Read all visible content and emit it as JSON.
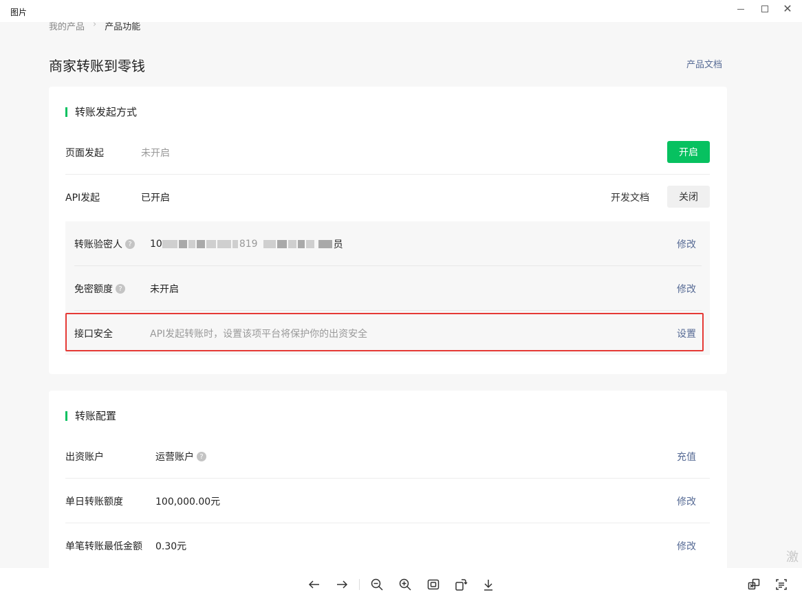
{
  "window": {
    "title": "图片",
    "close_glyph": "✕"
  },
  "breadcrumb": {
    "root": "我的产品",
    "separator": "›",
    "current": "产品功能"
  },
  "page": {
    "title": "商家转账到零钱",
    "doc_link": "产品文档"
  },
  "transfer_methods": {
    "title": "转账发起方式",
    "page_init": {
      "label": "页面发起",
      "status": "未开启",
      "button": "开启"
    },
    "api_init": {
      "label": "API发起",
      "status": "已开启",
      "dev_doc": "开发文档",
      "button": "关闭"
    },
    "verifier": {
      "label": "转账验密人",
      "value_prefix": "10",
      "value_mid": "819",
      "value_suffix": "员",
      "action": "修改"
    },
    "password_free": {
      "label": "免密额度",
      "value": "未开启",
      "action": "修改"
    },
    "api_security": {
      "label": "接口安全",
      "description": "API发起转账时，设置该项平台将保护你的出资安全",
      "action": "设置"
    }
  },
  "transfer_config": {
    "title": "转账配置",
    "funding_account": {
      "label": "出资账户",
      "value": "运营账户",
      "action": "充值"
    },
    "daily_limit": {
      "label": "单日转账额度",
      "value": "100,000.00元",
      "action": "修改"
    },
    "min_amount": {
      "label": "单笔转账最低金额",
      "value": "0.30元",
      "action": "修改"
    }
  },
  "help_glyph": "?",
  "watermark": "激",
  "colors": {
    "accent_green": "#07c160",
    "link_blue": "#576b95",
    "highlight_red": "#e53935"
  }
}
